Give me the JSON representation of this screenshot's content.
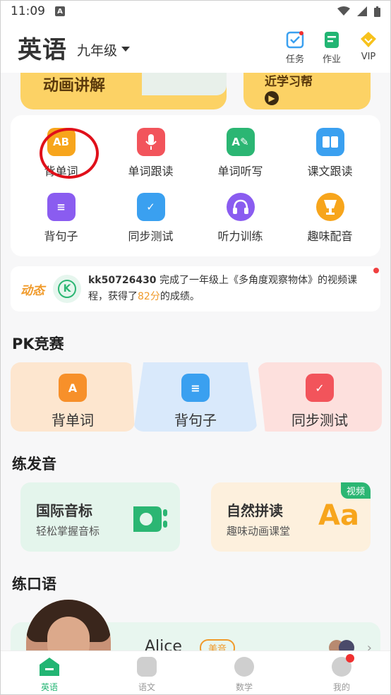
{
  "status_bar": {
    "time": "11:09"
  },
  "header": {
    "subject": "英语",
    "grade": "九年级",
    "tools": [
      {
        "label": "任务",
        "icon": "task-checklist-icon"
      },
      {
        "label": "作业",
        "icon": "homework-icon"
      },
      {
        "label": "VIP",
        "icon": "vip-diamond-icon"
      }
    ]
  },
  "banners": {
    "left_text": "动画讲解",
    "right_text": "近学习帮"
  },
  "grid": [
    {
      "label": "背单词",
      "icon": "ab-flashcard-icon",
      "color": "#f7a51c",
      "glyph": "AB"
    },
    {
      "label": "单词跟读",
      "icon": "microphone-icon",
      "color": "#f2545b",
      "glyph": "🎙"
    },
    {
      "label": "单词听写",
      "icon": "dictation-pen-icon",
      "color": "#2bb673",
      "glyph": "A✎"
    },
    {
      "label": "课文跟读",
      "icon": "open-book-icon",
      "color": "#3aa0f0",
      "glyph": "▤"
    },
    {
      "label": "背句子",
      "icon": "sentence-stack-icon",
      "color": "#8a5cf0",
      "glyph": "≡"
    },
    {
      "label": "同步测试",
      "icon": "clipboard-check-icon",
      "color": "#3aa0f0",
      "glyph": "✓"
    },
    {
      "label": "听力训练",
      "icon": "headphones-icon",
      "color": "#8a5cf0",
      "glyph": "🎧"
    },
    {
      "label": "趣味配音",
      "icon": "trophy-mic-icon",
      "color": "#f7a51c",
      "glyph": "♛"
    }
  ],
  "feed": {
    "tag": "动态",
    "user": "kk50726430",
    "message_before": " 完成了一年级上《多角度观察物体》的视频课程，获得了",
    "score": "82分",
    "message_after": "的成绩。"
  },
  "pk_section": {
    "title": "PK竞赛",
    "items": [
      {
        "label": "背单词",
        "bg": "#fde6cf",
        "icon_color": "#f7902a",
        "glyph": "A"
      },
      {
        "label": "背句子",
        "bg": "#d9e9fb",
        "icon_color": "#3aa0f0",
        "glyph": "≡"
      },
      {
        "label": "同步测试",
        "bg": "#fde0dd",
        "icon_color": "#f2545b",
        "glyph": "✓"
      }
    ]
  },
  "pronunciation": {
    "title": "练发音",
    "cards": [
      {
        "title": "国际音标",
        "subtitle": "轻松掌握音标",
        "bg": "#e4f5ec"
      },
      {
        "title": "自然拼读",
        "subtitle": "趣味动画课堂",
        "bg": "#fdf0dd",
        "badge": "视频",
        "art": "Aa"
      }
    ]
  },
  "speaking": {
    "title": "练口语",
    "name": "Alice",
    "accent": "美音"
  },
  "bottom_nav": [
    {
      "label": "英语",
      "active": true
    },
    {
      "label": "语文",
      "active": false
    },
    {
      "label": "数学",
      "active": false
    },
    {
      "label": "我的",
      "active": false,
      "dot": true
    }
  ]
}
